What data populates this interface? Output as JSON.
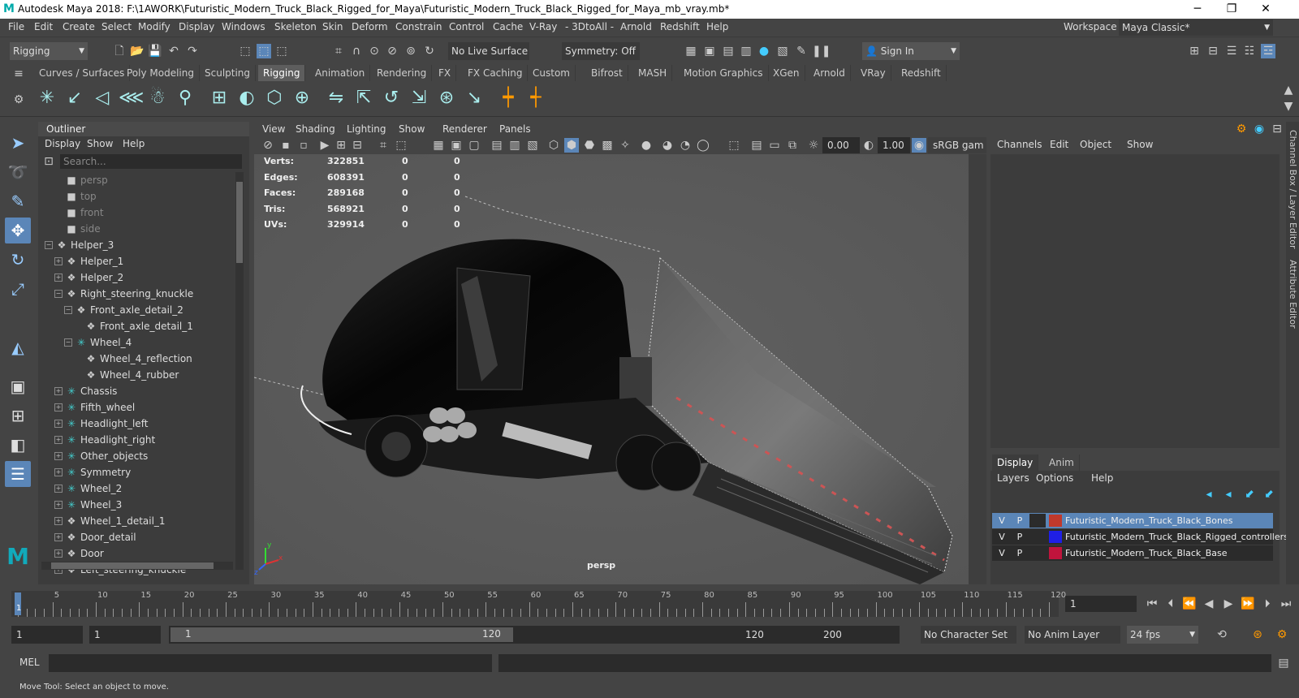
{
  "window": {
    "title": "Autodesk Maya 2018: F:\\1AWORK\\Futuristic_Modern_Truck_Black_Rigged_for_Maya\\Futuristic_Modern_Truck_Black_Rigged_for_Maya_mb_vray.mb*",
    "logo": "M"
  },
  "menubar": {
    "items": [
      "File",
      "Edit",
      "Create",
      "Select",
      "Modify",
      "Display",
      "Windows",
      "Skeleton",
      "Skin",
      "Deform",
      "Constrain",
      "Control",
      "Cache",
      "V-Ray",
      "- 3DtoAll -",
      "Arnold",
      "Redshift",
      "Help"
    ],
    "workspace_label": "Workspace :",
    "workspace_value": "Maya Classic*"
  },
  "statusline": {
    "menu_set": "Rigging",
    "live_surface": "No Live Surface",
    "symmetry": "Symmetry: Off",
    "sign_in": "Sign In"
  },
  "shelf": {
    "tabs": [
      "Curves / Surfaces",
      "Poly Modeling",
      "Sculpting",
      "Rigging",
      "Animation",
      "Rendering",
      "FX",
      "FX Caching",
      "Custom",
      "Bifrost",
      "MASH",
      "Motion Graphics",
      "XGen",
      "Arnold",
      "VRay",
      "Redshift"
    ],
    "active_tab": "Rigging"
  },
  "outliner": {
    "title": "Outliner",
    "menu": [
      "Display",
      "Show",
      "Help"
    ],
    "search_placeholder": "Search...",
    "rows": [
      {
        "label": "persp",
        "depth": 1,
        "icon": "camera",
        "dim": true,
        "exp": ""
      },
      {
        "label": "top",
        "depth": 1,
        "icon": "camera",
        "dim": true,
        "exp": ""
      },
      {
        "label": "front",
        "depth": 1,
        "icon": "camera",
        "dim": true,
        "exp": ""
      },
      {
        "label": "side",
        "depth": 1,
        "icon": "camera",
        "dim": true,
        "exp": ""
      },
      {
        "label": "Helper_3",
        "depth": 0,
        "icon": "transform",
        "dim": false,
        "exp": "−"
      },
      {
        "label": "Helper_1",
        "depth": 1,
        "icon": "transform",
        "dim": false,
        "exp": "+"
      },
      {
        "label": "Helper_2",
        "depth": 1,
        "icon": "transform",
        "dim": false,
        "exp": "+"
      },
      {
        "label": "Right_steering_knuckle",
        "depth": 1,
        "icon": "transform",
        "dim": false,
        "exp": "−"
      },
      {
        "label": "Front_axle_detail_2",
        "depth": 2,
        "icon": "transform",
        "dim": false,
        "exp": "−"
      },
      {
        "label": "Front_axle_detail_1",
        "depth": 3,
        "icon": "transform",
        "dim": false,
        "exp": ""
      },
      {
        "label": "Wheel_4",
        "depth": 2,
        "icon": "joint",
        "dim": false,
        "exp": "−"
      },
      {
        "label": "Wheel_4_reflection",
        "depth": 3,
        "icon": "transform",
        "dim": false,
        "exp": ""
      },
      {
        "label": "Wheel_4_rubber",
        "depth": 3,
        "icon": "transform",
        "dim": false,
        "exp": ""
      },
      {
        "label": "Chassis",
        "depth": 1,
        "icon": "joint",
        "dim": false,
        "exp": "+"
      },
      {
        "label": "Fifth_wheel",
        "depth": 1,
        "icon": "joint",
        "dim": false,
        "exp": "+"
      },
      {
        "label": "Headlight_left",
        "depth": 1,
        "icon": "joint",
        "dim": false,
        "exp": "+"
      },
      {
        "label": "Headlight_right",
        "depth": 1,
        "icon": "joint",
        "dim": false,
        "exp": "+"
      },
      {
        "label": "Other_objects",
        "depth": 1,
        "icon": "joint",
        "dim": false,
        "exp": "+"
      },
      {
        "label": "Symmetry",
        "depth": 1,
        "icon": "joint",
        "dim": false,
        "exp": "+"
      },
      {
        "label": "Wheel_2",
        "depth": 1,
        "icon": "joint",
        "dim": false,
        "exp": "+"
      },
      {
        "label": "Wheel_3",
        "depth": 1,
        "icon": "joint",
        "dim": false,
        "exp": "+"
      },
      {
        "label": "Wheel_1_detail_1",
        "depth": 1,
        "icon": "transform",
        "dim": false,
        "exp": "+"
      },
      {
        "label": "Door_detail",
        "depth": 1,
        "icon": "transform",
        "dim": false,
        "exp": "+"
      },
      {
        "label": "Door",
        "depth": 1,
        "icon": "transform",
        "dim": false,
        "exp": "+"
      },
      {
        "label": "Left_steering_knuckle",
        "depth": 1,
        "icon": "transform",
        "dim": false,
        "exp": "+"
      }
    ]
  },
  "viewport": {
    "menu": [
      "View",
      "Shading",
      "Lighting",
      "Show",
      "Renderer",
      "Panels"
    ],
    "field_a": "0.00",
    "field_b": "1.00",
    "color_space": "sRGB gam",
    "camera_label": "persp",
    "hud": [
      {
        "label": "Verts:",
        "v1": "322851",
        "v2": "0",
        "v3": "0"
      },
      {
        "label": "Edges:",
        "v1": "608391",
        "v2": "0",
        "v3": "0"
      },
      {
        "label": "Faces:",
        "v1": "289168",
        "v2": "0",
        "v3": "0"
      },
      {
        "label": "Tris:",
        "v1": "568921",
        "v2": "0",
        "v3": "0"
      },
      {
        "label": "UVs:",
        "v1": "329914",
        "v2": "0",
        "v3": "0"
      }
    ],
    "axis_y": "y",
    "axis_x": "x",
    "axis_z": "z"
  },
  "channelbox": {
    "menu": [
      "Channels",
      "Edit",
      "Object",
      "Show"
    ],
    "layer_tabs": [
      "Display",
      "Anim"
    ],
    "layer_menu": [
      "Layers",
      "Options",
      "Help"
    ],
    "layers": [
      {
        "v": "V",
        "p": "P",
        "color": "#c0392b",
        "name": "Futuristic_Modern_Truck_Black_Bones",
        "selected": true
      },
      {
        "v": "V",
        "p": "P",
        "color": "#1f1fe6",
        "name": "Futuristic_Modern_Truck_Black_Rigged_controllers",
        "selected": false
      },
      {
        "v": "V",
        "p": "P",
        "color": "#c0143c",
        "name": "Futuristic_Modern_Truck_Black_Base",
        "selected": false
      }
    ],
    "side_tab_1": "Channel Box / Layer Editor",
    "side_tab_2": "Attribute Editor"
  },
  "timeslider": {
    "ticks": [
      "5",
      "10",
      "15",
      "20",
      "25",
      "30",
      "35",
      "40",
      "45",
      "50",
      "55",
      "60",
      "65",
      "70",
      "75",
      "80",
      "85",
      "90",
      "95",
      "100",
      "105",
      "110",
      "115",
      "120"
    ],
    "current_frame_marker": "1",
    "current_frame": "1"
  },
  "rangeslider": {
    "start": "1",
    "playback_start": "1",
    "range_start_label": "1",
    "range_end_label": "120",
    "playback_end": "120",
    "end": "200",
    "character_set": "No Character Set",
    "anim_layer": "No Anim Layer",
    "fps": "24 fps"
  },
  "cmdline": {
    "label": "MEL"
  },
  "helpline": {
    "text": "Move Tool: Select an object to move."
  }
}
